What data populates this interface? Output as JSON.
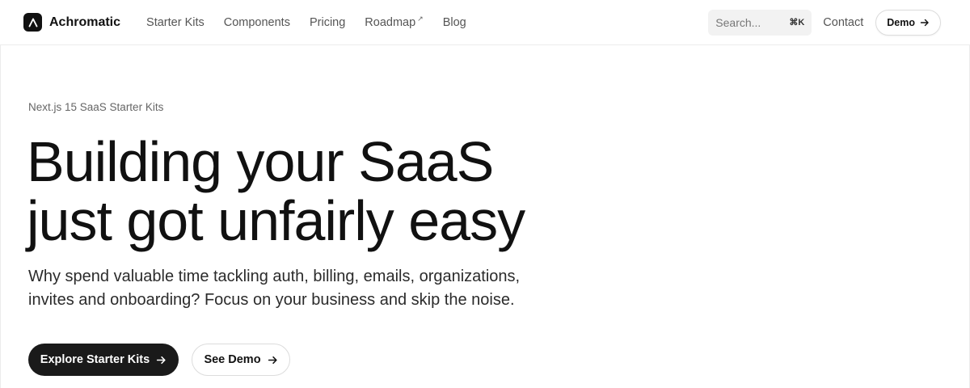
{
  "header": {
    "brand_name": "Achromatic",
    "logo_icon": "achromatic-logo-icon",
    "nav": [
      {
        "label": "Starter Kits"
      },
      {
        "label": "Components"
      },
      {
        "label": "Pricing"
      },
      {
        "label": "Roadmap",
        "external_icon": "↗"
      },
      {
        "label": "Blog"
      }
    ],
    "search": {
      "placeholder": "Search...",
      "shortcut": "⌘K"
    },
    "contact_label": "Contact",
    "demo_label": "Demo"
  },
  "hero": {
    "eyebrow": "Next.js 15 SaaS Starter Kits",
    "headline": [
      "Building your SaaS",
      "just got unfairly easy"
    ],
    "subheadline": [
      "Why spend valuable time tackling auth, billing, emails, organizations,",
      "invites and onboarding? Focus on your business and skip the noise."
    ],
    "primary_cta": "Explore Starter Kits",
    "secondary_cta": "See Demo"
  },
  "colors": {
    "primary_button_bg": "#1a1a1a",
    "text": "#111111",
    "muted_text": "#555555",
    "border": "#ececec"
  }
}
